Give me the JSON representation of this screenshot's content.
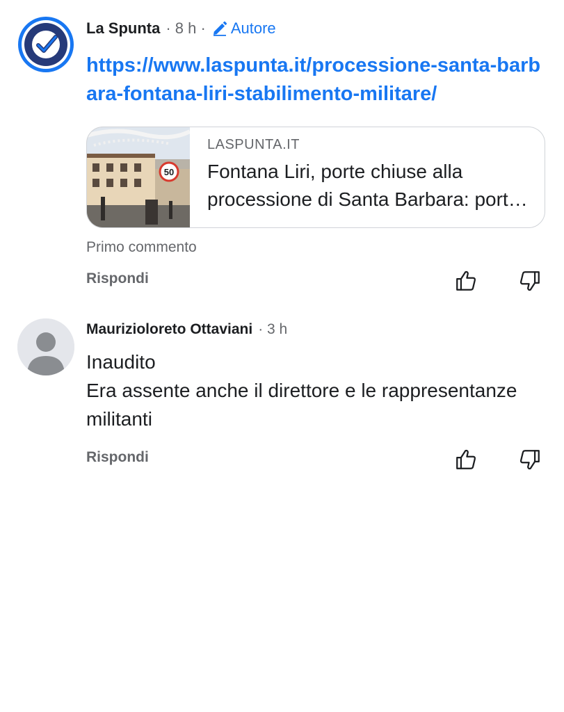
{
  "post": {
    "author": "La Spunta",
    "time": "· 8 h ·",
    "badge_label": "Autore",
    "link_text": "https://www.laspunta.it/processione-santa-barbara-fontana-liri-stabilimento-militare/",
    "preview": {
      "domain": "LASPUNTA.IT",
      "title": "Fontana Liri, porte chiuse alla processione di Santa Barbara: porte chiuse allo stabilimento militare",
      "image_sign": "50"
    },
    "first_comment_label": "Primo commento",
    "reply_label": "Rispondi"
  },
  "comment": {
    "author": "Maurizioloreto Ottaviani",
    "time": "· 3 h",
    "body": "Inaudito\nEra assente anche il direttore e le rappresentanze militanti",
    "reply_label": "Rispondi"
  },
  "icons": {
    "brand_avatar": "check-badge-icon",
    "badge": "pencil-icon",
    "like": "thumbs-up-icon",
    "dislike": "thumbs-down-icon",
    "default_avatar": "person-silhouette-icon"
  },
  "colors": {
    "accent": "#1877f2",
    "brand_ring": "#1877f2",
    "brand_fill": "#263a79",
    "muted_text": "#65676b",
    "card_border": "#d0d3d8"
  }
}
